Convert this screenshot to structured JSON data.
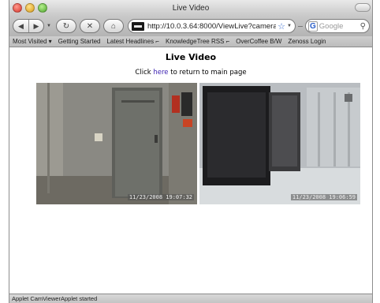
{
  "window": {
    "title": "Live Video"
  },
  "toolbar": {
    "url": "http://10.0.3.64:8000/ViewLive?cameraNu",
    "search_placeholder": "Google"
  },
  "bookmarks": [
    {
      "label": "Most Visited ▾"
    },
    {
      "label": "Getting Started"
    },
    {
      "label": "Latest Headlines ⌐"
    },
    {
      "label": "KnowledgeTree RSS ⌐"
    },
    {
      "label": "OverCoffee B/W"
    },
    {
      "label": "Zenoss Login"
    }
  ],
  "page": {
    "heading": "Live Video",
    "sub_prefix": "Click ",
    "sub_link": "here",
    "sub_suffix": " to return to main page"
  },
  "cameras": [
    {
      "timestamp": "11/23/2008 19:07:32"
    },
    {
      "timestamp": "11/23/2008 19:06:59"
    }
  ],
  "status": {
    "text": "Applet CamViewerApplet started"
  },
  "colors": {
    "link": "#3a1fb0",
    "url_star": "#3d6fd0"
  }
}
